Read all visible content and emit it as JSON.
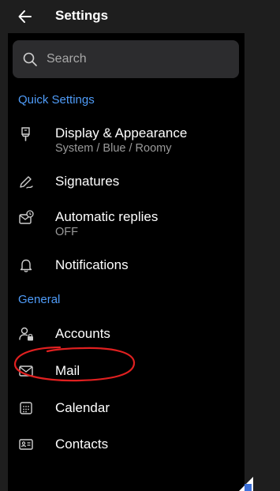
{
  "header": {
    "title": "Settings",
    "back_icon": "back-arrow-icon"
  },
  "search": {
    "placeholder": "Search",
    "icon": "search-icon"
  },
  "sections": {
    "quick_settings": {
      "title": "Quick Settings",
      "items": [
        {
          "label": "Display & Appearance",
          "sub": "System / Blue / Roomy",
          "icon": "display-icon"
        },
        {
          "label": "Signatures",
          "icon": "signature-icon"
        },
        {
          "label": "Automatic replies",
          "sub": "OFF",
          "icon": "auto-reply-icon"
        },
        {
          "label": "Notifications",
          "icon": "bell-icon"
        }
      ]
    },
    "general": {
      "title": "General",
      "items": [
        {
          "label": "Accounts",
          "icon": "accounts-icon"
        },
        {
          "label": "Mail",
          "icon": "mail-icon"
        },
        {
          "label": "Calendar",
          "icon": "calendar-icon"
        },
        {
          "label": "Contacts",
          "icon": "contacts-icon"
        }
      ]
    }
  },
  "colors": {
    "accent": "#4f9cf9",
    "background": "#000000",
    "annotation": "#e02020"
  }
}
